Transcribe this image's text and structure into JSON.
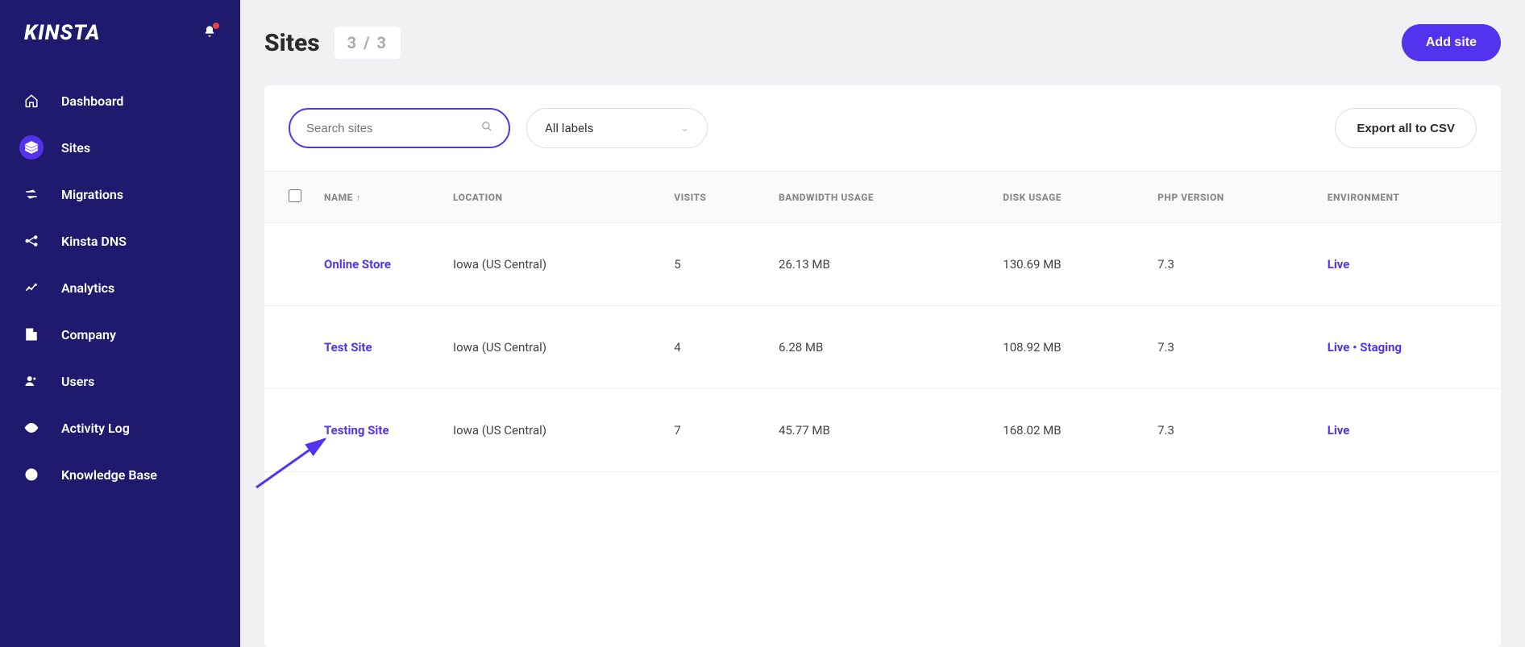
{
  "logo": "KINSTA",
  "sidebar": {
    "items": [
      {
        "label": "Dashboard"
      },
      {
        "label": "Sites"
      },
      {
        "label": "Migrations"
      },
      {
        "label": "Kinsta DNS"
      },
      {
        "label": "Analytics"
      },
      {
        "label": "Company"
      },
      {
        "label": "Users"
      },
      {
        "label": "Activity Log"
      },
      {
        "label": "Knowledge Base"
      }
    ]
  },
  "header": {
    "title": "Sites",
    "count": "3 / 3",
    "add_button": "Add site"
  },
  "toolbar": {
    "search_placeholder": "Search sites",
    "labels_text": "All labels",
    "export_button": "Export all to CSV"
  },
  "table": {
    "columns": {
      "name": "NAME",
      "location": "LOCATION",
      "visits": "VISITS",
      "bandwidth": "BANDWIDTH USAGE",
      "disk": "DISK USAGE",
      "php": "PHP VERSION",
      "environment": "ENVIRONMENT"
    },
    "rows": [
      {
        "name": "Online Store",
        "location": "Iowa (US Central)",
        "visits": "5",
        "bandwidth": "26.13 MB",
        "disk": "130.69 MB",
        "php": "7.3",
        "env": [
          "Live"
        ]
      },
      {
        "name": "Test Site",
        "location": "Iowa (US Central)",
        "visits": "4",
        "bandwidth": "6.28 MB",
        "disk": "108.92 MB",
        "php": "7.3",
        "env": [
          "Live",
          "Staging"
        ]
      },
      {
        "name": "Testing Site",
        "location": "Iowa (US Central)",
        "visits": "7",
        "bandwidth": "45.77 MB",
        "disk": "168.02 MB",
        "php": "7.3",
        "env": [
          "Live"
        ]
      }
    ]
  }
}
